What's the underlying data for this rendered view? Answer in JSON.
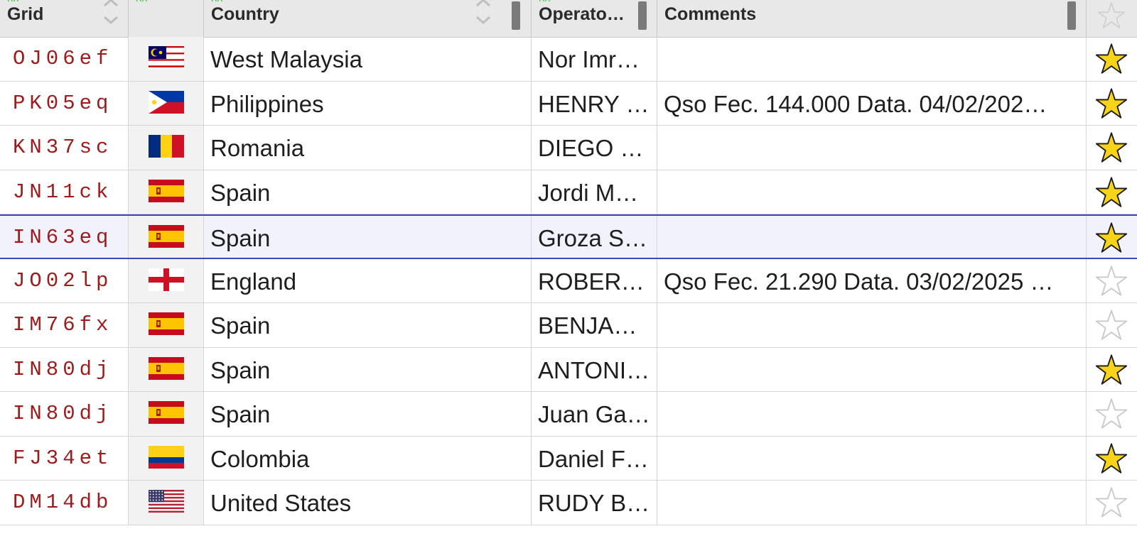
{
  "header": {
    "rx_tag": "RX",
    "columns": {
      "grid": "Grid",
      "country": "Country",
      "operator": "Operato…",
      "comments": "Comments"
    }
  },
  "colors": {
    "grid_text": "#9e1b1b",
    "star_fill": "#f7d417",
    "selection_border": "#3848b8",
    "rx_tag": "#2fbf2f"
  },
  "rows": [
    {
      "grid": "OJ06ef",
      "flag": "malaysia-flag-icon",
      "country": "West Malaysia",
      "operator": "Nor Imr…",
      "comments": "",
      "starred": true,
      "selected": false
    },
    {
      "grid": "PK05eq",
      "flag": "philippines-flag-icon",
      "country": "Philippines",
      "operator": "HENRY …",
      "comments": "Qso Fec. 144.000 Data. 04/02/202…",
      "starred": true,
      "selected": false
    },
    {
      "grid": "KN37sc",
      "flag": "romania-flag-icon",
      "country": "Romania",
      "operator": "DIEGO G…",
      "comments": "",
      "starred": true,
      "selected": false
    },
    {
      "grid": "JN11ck",
      "flag": "spain-flag-icon",
      "country": "Spain",
      "operator": "Jordi M…",
      "comments": "",
      "starred": true,
      "selected": false
    },
    {
      "grid": "IN63eq",
      "flag": "spain-flag-icon",
      "country": "Spain",
      "operator": "Groza Si…",
      "comments": "",
      "starred": true,
      "selected": true
    },
    {
      "grid": "JO02lp",
      "flag": "england-flag-icon",
      "country": "England",
      "operator": "ROBERT…",
      "comments": "Qso Fec. 21.290 Data. 03/02/2025 …",
      "starred": false,
      "selected": false
    },
    {
      "grid": "IM76fx",
      "flag": "spain-flag-icon",
      "country": "Spain",
      "operator": "BENJA…",
      "comments": "",
      "starred": false,
      "selected": false
    },
    {
      "grid": "IN80dj",
      "flag": "spain-flag-icon",
      "country": "Spain",
      "operator": "ANTONI…",
      "comments": "",
      "starred": true,
      "selected": false
    },
    {
      "grid": "IN80dj",
      "flag": "spain-flag-icon",
      "country": "Spain",
      "operator": "Juan Ga…",
      "comments": "",
      "starred": false,
      "selected": false
    },
    {
      "grid": "FJ34et",
      "flag": "colombia-flag-icon",
      "country": "Colombia",
      "operator": "Daniel F …",
      "comments": "",
      "starred": true,
      "selected": false
    },
    {
      "grid": "DM14db",
      "flag": "usa-flag-icon",
      "country": "United States",
      "operator": "RUDY B …",
      "comments": "",
      "starred": false,
      "selected": false
    }
  ]
}
